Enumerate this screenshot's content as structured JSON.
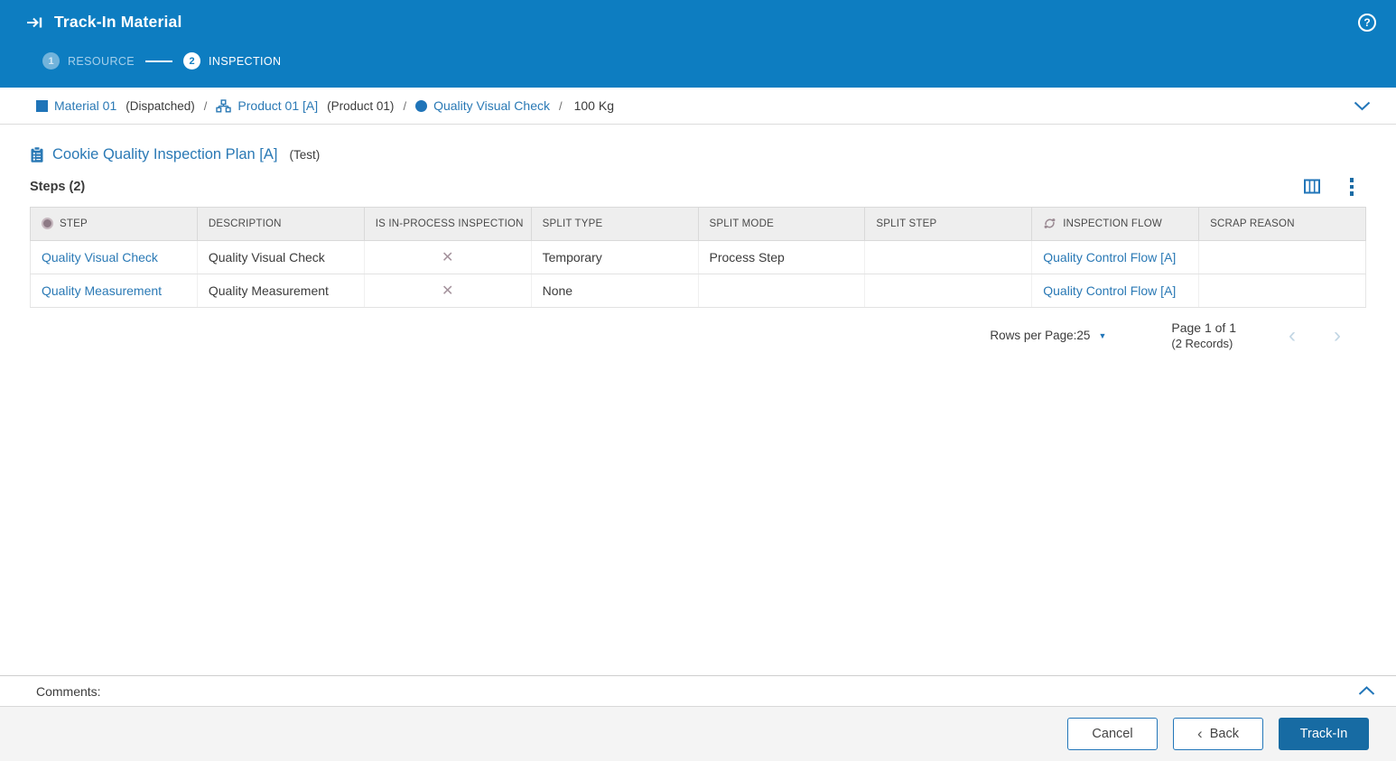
{
  "colors": {
    "header_blue": "#0d7dc1",
    "link_blue": "#2a79b5",
    "primary_button_blue": "#176ba3",
    "false_mark_mauve": "#a5939d"
  },
  "header": {
    "title": "Track-In Material",
    "title_icon": "track-in-arrow-to-bar",
    "help_icon": "question-mark-circle",
    "help_glyph": "?"
  },
  "wizard": {
    "steps": [
      {
        "number": "1",
        "label": "RESOURCE",
        "state": "done"
      },
      {
        "number": "2",
        "label": "INSPECTION",
        "state": "active"
      }
    ]
  },
  "breadcrumb": {
    "separator": "/",
    "material": {
      "icon": "material-square-icon",
      "label": "Material 01",
      "note": "(Dispatched)"
    },
    "product": {
      "icon": "product-hierarchy-icon",
      "label": "Product 01 [A]",
      "note": "(Product 01)"
    },
    "step": {
      "icon": "step-circle-icon",
      "label": "Quality Visual Check"
    },
    "quantity": "100 Kg",
    "collapse_icon": "chevron-down"
  },
  "plan": {
    "icon": "inspection-plan-clipboard-icon",
    "title": "Cookie Quality Inspection Plan [A]",
    "subtitle": "(Test)",
    "steps_label": "Steps (2)",
    "tools": {
      "columns_icon": "column-chooser",
      "menu_icon": "kebab-menu"
    }
  },
  "table": {
    "columns": [
      "STEP",
      "DESCRIPTION",
      "IS IN-PROCESS INSPECTION",
      "SPLIT TYPE",
      "SPLIT MODE",
      "SPLIT STEP",
      "INSPECTION FLOW",
      "SCRAP REASON"
    ],
    "rows": [
      {
        "step": "Quality Visual Check",
        "description": "Quality Visual Check",
        "is_in_process_icon": "✕",
        "split_type": "Temporary",
        "split_mode": "Process Step",
        "split_step": "",
        "inspection_flow": "Quality Control Flow [A]",
        "scrap_reason": ""
      },
      {
        "step": "Quality Measurement",
        "description": "Quality Measurement",
        "is_in_process_icon": "✕",
        "split_type": "None",
        "split_mode": "",
        "split_step": "",
        "inspection_flow": "Quality Control Flow [A]",
        "scrap_reason": ""
      }
    ]
  },
  "pagination": {
    "rows_per_page_label": "Rows per Page:",
    "rows_per_page_value": "25",
    "caret_icon": "▼",
    "page_info": "Page 1 of 1",
    "records_info": "(2 Records)",
    "prev_icon": "‹",
    "next_icon": "›"
  },
  "comments": {
    "label": "Comments:",
    "collapse_icon": "chevron-up"
  },
  "footer": {
    "cancel_label": "Cancel",
    "back_icon": "‹",
    "back_label": "Back",
    "track_in_label": "Track-In"
  }
}
